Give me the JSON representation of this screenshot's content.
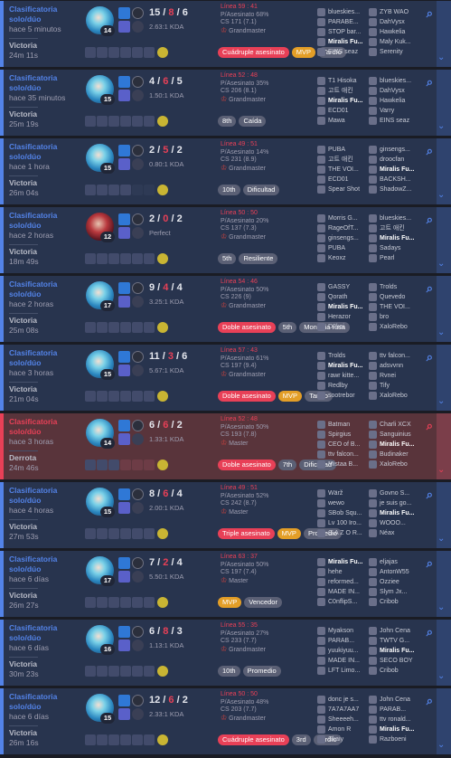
{
  "icons": {
    "champion": "champion-portrait-icon",
    "spell": "summoner-spell-icon",
    "rune": "rune-icon",
    "item": "item-icon",
    "ward": "ward-icon",
    "search": "search-icon",
    "expand": "chevron-down-icon"
  },
  "colors": {
    "win": "#5383e8",
    "loss": "#e84057",
    "mvp": "#e39e27"
  },
  "me": "Miralis Fu...",
  "matches": [
    {
      "queue": "Clasificatoria solo/dúo",
      "time": "hace 5 minutos",
      "result": "Victoria",
      "duration": "24m 11s",
      "level": "14",
      "k": "15",
      "d": "8",
      "a": "6",
      "kda": "2.63:1 KDA",
      "lp": "Línea 59 : 41",
      "kp": "P/Asesinato 68%",
      "cs": "CS 171 (7.1)",
      "rank": "Grandmaster",
      "win": true,
      "empty_items": 0,
      "tags": [
        {
          "t": "Cuádruple asesinato",
          "c": "red"
        },
        {
          "t": "MVP",
          "c": "mvp"
        },
        {
          "t": "Tardío",
          "c": ""
        }
      ],
      "t1": [
        "blueskies...",
        "PARABE...",
        "STOP bar...",
        "Miralis Fu...",
        "EINS seaz"
      ],
      "t2": [
        "ZYB WAO",
        "DahVysx",
        "Hawkelia",
        "Maly Kuk...",
        "Serenity"
      ]
    },
    {
      "queue": "Clasificatoria solo/dúo",
      "time": "hace 35 minutos",
      "result": "Victoria",
      "duration": "25m 19s",
      "level": "15",
      "k": "4",
      "d": "6",
      "a": "5",
      "kda": "1.50:1 KDA",
      "lp": "Línea 52 : 48",
      "kp": "P/Asesinato 35%",
      "cs": "CS 206 (8.1)",
      "rank": "Grandmaster",
      "win": true,
      "empty_items": 0,
      "tags": [
        {
          "t": "8th",
          "c": ""
        },
        {
          "t": "Caída",
          "c": ""
        }
      ],
      "t1": [
        "T1 Hisoka",
        "고트 애킨",
        "Miralis Fu...",
        "ECD01",
        "Mawa"
      ],
      "t2": [
        "blueskies...",
        "DahVysx",
        "Hawkelia",
        "Varry",
        "EINS seaz"
      ]
    },
    {
      "queue": "Clasificatoria solo/dúo",
      "time": "hace 1 hora",
      "result": "Victoria",
      "duration": "26m 04s",
      "level": "15",
      "k": "2",
      "d": "5",
      "a": "2",
      "kda": "0.80:1 KDA",
      "lp": "Línea 49 : 51",
      "kp": "P/Asesinato 14%",
      "cs": "CS 231 (8.9)",
      "rank": "Grandmaster",
      "win": true,
      "empty_items": 2,
      "tags": [
        {
          "t": "10th",
          "c": ""
        },
        {
          "t": "Dificultad",
          "c": ""
        }
      ],
      "t1": [
        "PUBA",
        "고트 애킨",
        "THE VOI...",
        "ECD01",
        "Spear Shot"
      ],
      "t2": [
        "ginsengs...",
        "droocfan",
        "Miralis Fu...",
        "BACKSH...",
        "ShadowZ..."
      ]
    },
    {
      "queue": "Clasificatoria solo/dúo",
      "time": "hace 2 horas",
      "result": "Victoria",
      "duration": "18m 49s",
      "level": "12",
      "k": "2",
      "d": "0",
      "a": "2",
      "kda": "Perfect",
      "lp": "Línea 50 : 50",
      "kp": "P/Asesinato 20%",
      "cs": "CS 137 (7.3)",
      "rank": "Grandmaster",
      "win": true,
      "alt": true,
      "empty_items": 0,
      "tags": [
        {
          "t": "5th",
          "c": ""
        },
        {
          "t": "Resiliente",
          "c": ""
        }
      ],
      "t1": [
        "Morris G...",
        "RageOfT...",
        "ginsengs...",
        "PUBA",
        "Keoxz"
      ],
      "t2": [
        "blueskies...",
        "고트 애킨",
        "Miralis Fu...",
        "Sadays",
        "Pearl"
      ]
    },
    {
      "queue": "Clasificatoria solo/dúo",
      "time": "hace 2 horas",
      "result": "Victoria",
      "duration": "25m 08s",
      "level": "17",
      "k": "9",
      "d": "4",
      "a": "4",
      "kda": "3.25:1 KDA",
      "lp": "Línea 54 : 46",
      "kp": "P/Asesinato 50%",
      "cs": "CS 226 (9)",
      "rank": "Grandmaster",
      "win": true,
      "empty_items": 0,
      "tags": [
        {
          "t": "Doble asesinato",
          "c": "red"
        },
        {
          "t": "5th",
          "c": ""
        },
        {
          "t": "Montaña rusa",
          "c": ""
        }
      ],
      "t1": [
        "GASSY",
        "Qorath",
        "Miralis Fu...",
        "Herazor",
        "D0kai"
      ],
      "t2": [
        "Trolds",
        "Quevedo",
        "THE VOI...",
        "bro",
        "XaloRebo"
      ]
    },
    {
      "queue": "Clasificatoria solo/dúo",
      "time": "hace 3 horas",
      "result": "Victoria",
      "duration": "21m 04s",
      "level": "15",
      "k": "11",
      "d": "3",
      "a": "6",
      "kda": "5.67:1 KDA",
      "lp": "Línea 57 : 43",
      "kp": "P/Asesinato 61%",
      "cs": "CS 197 (9.4)",
      "rank": "Grandmaster",
      "win": true,
      "empty_items": 0,
      "tags": [
        {
          "t": "Doble asesinato",
          "c": "red"
        },
        {
          "t": "MVP",
          "c": "mvp"
        },
        {
          "t": "Tardío",
          "c": ""
        }
      ],
      "t1": [
        "Trolds",
        "Miralis Fu...",
        "rawr kitte...",
        "Redlby",
        "sootrebor"
      ],
      "t2": [
        "ttv falcon...",
        "adsvvnn",
        "Rvnei",
        "Tify",
        "XaloRebo"
      ]
    },
    {
      "queue": "Clasificatoria solo/dúo",
      "time": "hace 3 horas",
      "result": "Derrota",
      "duration": "24m 46s",
      "level": "14",
      "k": "6",
      "d": "6",
      "a": "2",
      "kda": "1.33:1 KDA",
      "lp": "Línea 52 : 48",
      "kp": "P/Asesinato 50%",
      "cs": "CS 193 (7.8)",
      "rank": "Master",
      "win": false,
      "empty_items": 3,
      "tags": [
        {
          "t": "Doble asesinato",
          "c": "red"
        },
        {
          "t": "7th",
          "c": ""
        },
        {
          "t": "Dificultad",
          "c": ""
        }
      ],
      "t1": [
        "Batman",
        "Spirgius",
        "CEO of B...",
        "ttv falcon...",
        "Mistaa B..."
      ],
      "t2": [
        "Charli XCX",
        "Sanguinius",
        "Miralis Fu...",
        "Budinaker",
        "XaloRebo"
      ]
    },
    {
      "queue": "Clasificatoria solo/dúo",
      "time": "hace 4 horas",
      "result": "Victoria",
      "duration": "27m 53s",
      "level": "15",
      "k": "8",
      "d": "6",
      "a": "4",
      "kda": "2.00:1 KDA",
      "lp": "Línea 49 : 51",
      "kp": "P/Asesinato 52%",
      "cs": "CS 242 (8.7)",
      "rank": "Master",
      "win": true,
      "empty_items": 0,
      "tags": [
        {
          "t": "Triple asesinato",
          "c": "red"
        },
        {
          "t": "MVP",
          "c": "mvp"
        },
        {
          "t": "Promedio",
          "c": ""
        }
      ],
      "t1": [
        "Wärž",
        "wewo",
        "SBob Squ...",
        "Lv 100 Iro...",
        "G A Z O R..."
      ],
      "t2": [
        "Govno S...",
        "je suis go...",
        "Miralis Fu...",
        "WOOO...",
        "Néax"
      ]
    },
    {
      "queue": "Clasificatoria solo/dúo",
      "time": "hace 6 días",
      "result": "Victoria",
      "duration": "26m 27s",
      "level": "17",
      "k": "7",
      "d": "2",
      "a": "4",
      "kda": "5.50:1 KDA",
      "lp": "Línea 63 : 37",
      "kp": "P/Asesinato 50%",
      "cs": "CS 197 (7.4)",
      "rank": "Master",
      "win": true,
      "empty_items": 0,
      "tags": [
        {
          "t": "MVP",
          "c": "mvp"
        },
        {
          "t": "Vencedor",
          "c": ""
        }
      ],
      "t1": [
        "Miralis Fu...",
        "hehe",
        "reformed...",
        "MADE IN...",
        "C0nflipS..."
      ],
      "t2": [
        "eljajas",
        "AntonW55",
        "Ozziee",
        "Slym Jx...",
        "Cribob"
      ]
    },
    {
      "queue": "Clasificatoria solo/dúo",
      "time": "hace 6 días",
      "result": "Victoria",
      "duration": "30m 23s",
      "level": "16",
      "k": "6",
      "d": "8",
      "a": "3",
      "kda": "1.13:1 KDA",
      "lp": "Línea 55 : 35",
      "kp": "P/Asesinato 27%",
      "cs": "CS 233 (7.7)",
      "rank": "Grandmaster",
      "win": true,
      "empty_items": 0,
      "tags": [
        {
          "t": "10th",
          "c": ""
        },
        {
          "t": "Promedio",
          "c": ""
        }
      ],
      "t1": [
        "Myakson",
        "PARAB...",
        "yuukiyuu...",
        "MADE IN...",
        "LFT Limo..."
      ],
      "t2": [
        "John Cena",
        "TWTV G...",
        "Miralis Fu...",
        "SECO BOY",
        "Cribob"
      ]
    },
    {
      "queue": "Clasificatoria solo/dúo",
      "time": "hace 6 días",
      "result": "Victoria",
      "duration": "26m 16s",
      "level": "15",
      "k": "12",
      "d": "6",
      "a": "2",
      "kda": "2.33:1 KDA",
      "lp": "Línea 50 : 50",
      "kp": "P/Asesinato 48%",
      "cs": "CS 203 (7.7)",
      "rank": "Grandmaster",
      "win": true,
      "empty_items": 0,
      "tags": [
        {
          "t": "Cuádruple asesinato",
          "c": "red"
        },
        {
          "t": "3rd",
          "c": ""
        },
        {
          "t": "Tardío",
          "c": ""
        }
      ],
      "t1": [
        "donc je s...",
        "7A7A7AA7",
        "Sheeeeh...",
        "Amon R",
        "Skaiy"
      ],
      "t2": [
        "John Cena",
        "PARAB...",
        "ttv ronald...",
        "Miralis Fu...",
        "Razboeni"
      ]
    }
  ]
}
